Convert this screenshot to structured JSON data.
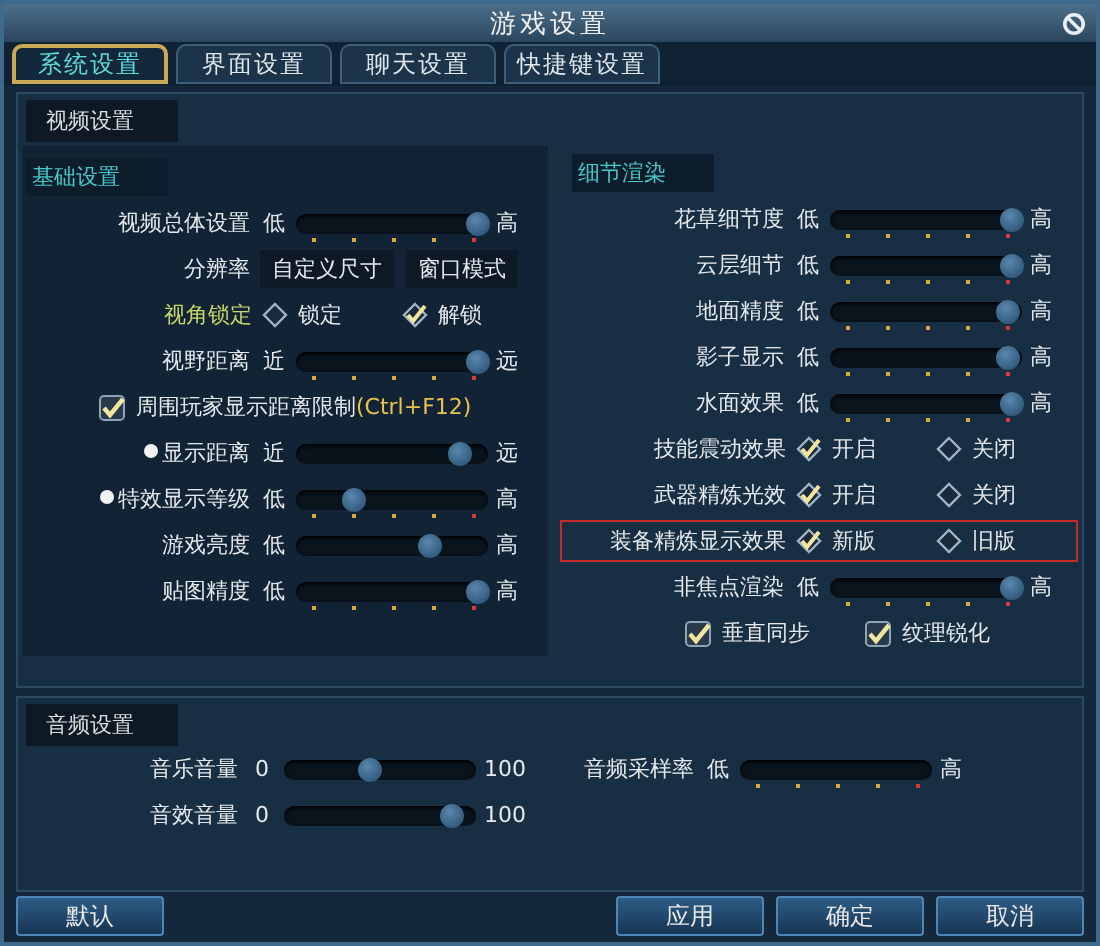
{
  "window": {
    "title": "游戏设置"
  },
  "tabs": [
    {
      "label": "系统设置",
      "selected": true
    },
    {
      "label": "界面设置",
      "selected": false
    },
    {
      "label": "聊天设置",
      "selected": false
    },
    {
      "label": "快捷键设置",
      "selected": false
    }
  ],
  "video": {
    "title": "视频设置",
    "columns": [
      {
        "heading": "基础设置",
        "rows": [
          {
            "kind": "slider",
            "label": "视频总体设置",
            "low": "低",
            "high": "高",
            "level": 0.95,
            "ticks": true,
            "bullet": false
          },
          {
            "kind": "fields",
            "label": "分辨率",
            "fields": [
              "自定义尺寸",
              "窗口模式"
            ]
          },
          {
            "kind": "radio",
            "label": "视角锁定",
            "accent": true,
            "highlighted": false,
            "options": [
              {
                "label": "锁定",
                "selected": false
              },
              {
                "label": "解锁",
                "selected": true
              }
            ]
          },
          {
            "kind": "slider",
            "label": "视野距离",
            "low": "近",
            "high": "远",
            "level": 0.95,
            "ticks": true,
            "bullet": false
          },
          {
            "kind": "checkbox",
            "items": [
              {
                "label": "周围玩家显示距离限制",
                "hint": "(Ctrl+F12)",
                "checked": true
              }
            ]
          },
          {
            "kind": "slider",
            "label": "显示距离",
            "low": "近",
            "high": "远",
            "level": 0.85,
            "ticks": false,
            "bullet": true
          },
          {
            "kind": "slider",
            "label": "特效显示等级",
            "low": "低",
            "high": "高",
            "level": 0.3,
            "ticks": true,
            "bullet": true
          },
          {
            "kind": "slider",
            "label": "游戏亮度",
            "low": "低",
            "high": "高",
            "level": 0.7,
            "ticks": false,
            "bullet": false
          },
          {
            "kind": "slider",
            "label": "贴图精度",
            "low": "低",
            "high": "高",
            "level": 0.95,
            "ticks": true,
            "bullet": false
          }
        ]
      },
      {
        "heading": "细节渲染",
        "rows": [
          {
            "kind": "slider",
            "label": "花草细节度",
            "low": "低",
            "high": "高",
            "level": 0.95,
            "ticks": true,
            "bullet": false
          },
          {
            "kind": "slider",
            "label": "云层细节",
            "low": "低",
            "high": "高",
            "level": 0.95,
            "ticks": true,
            "bullet": false
          },
          {
            "kind": "slider",
            "label": "地面精度",
            "low": "低",
            "high": "高",
            "level": 0.93,
            "ticks": true,
            "bullet": false
          },
          {
            "kind": "slider",
            "label": "影子显示",
            "low": "低",
            "high": "高",
            "level": 0.93,
            "ticks": true,
            "bullet": false
          },
          {
            "kind": "slider",
            "label": "水面效果",
            "low": "低",
            "high": "高",
            "level": 0.95,
            "ticks": true,
            "bullet": false
          },
          {
            "kind": "radio",
            "label": "技能震动效果",
            "accent": false,
            "highlighted": false,
            "options": [
              {
                "label": "开启",
                "selected": true
              },
              {
                "label": "关闭",
                "selected": false
              }
            ]
          },
          {
            "kind": "radio",
            "label": "武器精炼光效",
            "accent": false,
            "highlighted": false,
            "options": [
              {
                "label": "开启",
                "selected": true
              },
              {
                "label": "关闭",
                "selected": false
              }
            ]
          },
          {
            "kind": "radio",
            "label": "装备精炼显示效果",
            "accent": false,
            "highlighted": true,
            "options": [
              {
                "label": "新版",
                "selected": true
              },
              {
                "label": "旧版",
                "selected": false
              }
            ]
          },
          {
            "kind": "slider",
            "label": "非焦点渲染",
            "low": "低",
            "high": "高",
            "level": 0.95,
            "ticks": true,
            "bullet": false
          },
          {
            "kind": "checkbox",
            "items": [
              {
                "label": "垂直同步",
                "checked": true
              },
              {
                "label": "纹理锐化",
                "checked": true
              }
            ]
          }
        ]
      }
    ]
  },
  "audio": {
    "title": "音频设置",
    "columns": [
      {
        "rows": [
          {
            "kind": "slider",
            "label": "音乐音量",
            "low": "0",
            "high": "100",
            "level": 0.45,
            "ticks": false,
            "bullet": false
          },
          {
            "kind": "slider",
            "label": "音效音量",
            "low": "0",
            "high": "100",
            "level": 0.88,
            "ticks": false,
            "bullet": false
          }
        ]
      },
      {
        "rows": [
          {
            "kind": "slider",
            "label": "音频采样率",
            "low": "低",
            "high": "高",
            "ticks": true,
            "bullet": false
          }
        ]
      }
    ]
  },
  "buttons": {
    "left": [
      "默认"
    ],
    "right": [
      "应用",
      "确定",
      "取消"
    ]
  }
}
